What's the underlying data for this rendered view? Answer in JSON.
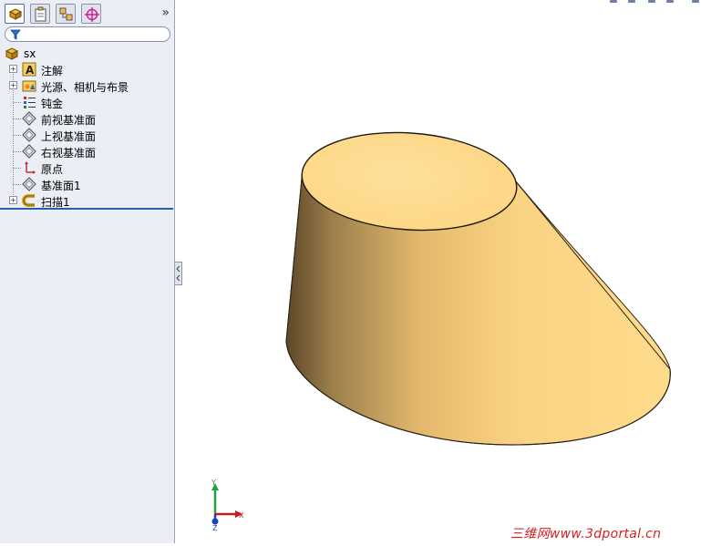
{
  "feature_manager": {
    "tabs": [
      {
        "name": "featuremanager-tab",
        "active": true
      },
      {
        "name": "propertymanager-tab",
        "active": false
      },
      {
        "name": "configurationmanager-tab",
        "active": false
      },
      {
        "name": "dimxpert-tab",
        "active": false
      }
    ],
    "expand_glyph": "»",
    "filter_icon": "filter-icon",
    "tree": [
      {
        "label": "sx",
        "icon": "part-icon",
        "expandable": false
      },
      {
        "label": "注解",
        "icon": "annotations-icon",
        "expandable": true
      },
      {
        "label": "光源、相机与布景",
        "icon": "lights-cameras-scene-icon",
        "expandable": true
      },
      {
        "label": "钝金",
        "icon": "material-icon",
        "expandable": false
      },
      {
        "label": "前视基准面",
        "icon": "plane-icon",
        "expandable": false
      },
      {
        "label": "上视基准面",
        "icon": "plane-icon",
        "expandable": false
      },
      {
        "label": "右视基准面",
        "icon": "plane-icon",
        "expandable": false
      },
      {
        "label": "原点",
        "icon": "origin-icon",
        "expandable": false
      },
      {
        "label": "基准面1",
        "icon": "plane-icon",
        "expandable": false
      },
      {
        "label": "扫描1",
        "icon": "sweep-icon",
        "expandable": true
      }
    ]
  },
  "viewport": {
    "model_color": "#f5c36e",
    "triad": {
      "x_label": "X",
      "y_label": "Y",
      "z_label": "Z"
    }
  },
  "watermark": "三维网www.3dportal.cn"
}
